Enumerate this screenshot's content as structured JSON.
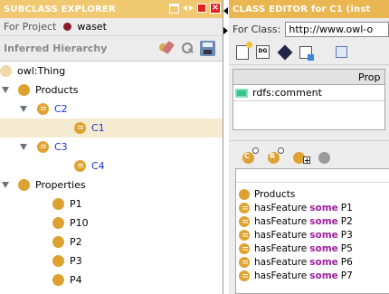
{
  "subclass_explorer": {
    "title": "SUBCLASS EXPLORER",
    "project_label": "For Project",
    "project_name": "waset",
    "hierarchy_label": "Inferred Hierarchy",
    "tree": {
      "root": "owl:Thing",
      "products": "Products",
      "c2": "C2",
      "c1": "C1",
      "c3": "C3",
      "c4": "C4",
      "properties": "Properties",
      "p1": "P1",
      "p10": "P10",
      "p2": "P2",
      "p3": "P3",
      "p4": "P4"
    },
    "selected_item": "C1"
  },
  "class_editor": {
    "title": "CLASS EDITOR for C1  (inst",
    "for_class_label": "For Class:",
    "class_uri": "http://www.owl-o",
    "properties_header": "Prop",
    "annotation_property": "rdfs:comment",
    "conditions": [
      {
        "kind": "class",
        "text": "Products"
      },
      {
        "kind": "restriction",
        "prop": "hasFeature",
        "kw": "some",
        "filler": "P1"
      },
      {
        "kind": "restriction",
        "prop": "hasFeature",
        "kw": "some",
        "filler": "P2"
      },
      {
        "kind": "restriction",
        "prop": "hasFeature",
        "kw": "some",
        "filler": "P3"
      },
      {
        "kind": "restriction",
        "prop": "hasFeature",
        "kw": "some",
        "filler": "P5"
      },
      {
        "kind": "restriction",
        "prop": "hasFeature",
        "kw": "some",
        "filler": "P6"
      },
      {
        "kind": "restriction",
        "prop": "hasFeature",
        "kw": "some",
        "filler": "P7"
      }
    ]
  },
  "colors": {
    "title_bar": "#f0c870",
    "class_icon": "#dca130",
    "named_class_text": "#1a34c4",
    "selected_row": "#f5ebd1",
    "keyword": "#a020a0"
  },
  "icons": [
    "maximize-icon",
    "split-arrows-icon",
    "minimize-icon",
    "close-icon",
    "project-icon",
    "create-subclass-icon",
    "find-class-icon",
    "save-icon"
  ]
}
